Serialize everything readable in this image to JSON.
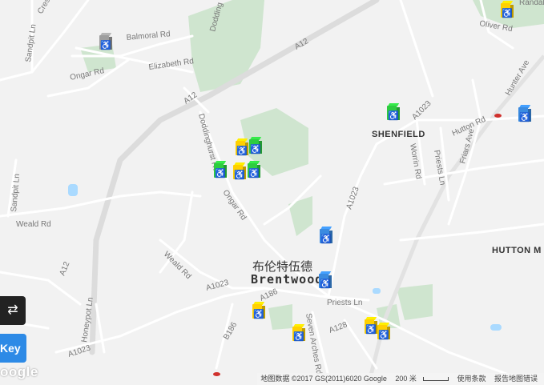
{
  "map": {
    "roads": {
      "crescent": "Crescent",
      "dodding_top": "Dodding",
      "sandpit_ln_top": "Sandpit Ln",
      "balmoral_rd": "Balmoral Rd",
      "elizabeth_rd": "Elizabeth Rd",
      "ongar_rd_top": "Ongar Rd",
      "a12_upper": "A12",
      "a12_mid": "A12",
      "a12_lower": "A12",
      "doddinghurst_rd": "Doddinghurst Rd",
      "ongar_rd_mid": "Ongar Rd",
      "sandpit_ln_left": "Sandpit Ln",
      "weald_rd_left": "Weald Rd",
      "weald_rd_mid": "Weald Rd",
      "a1023_mid": "A1023",
      "a1023_right": "A1023",
      "a1023_bottom": "A1023",
      "a1023_vertical": "A1023",
      "honeypot_ln": "Honeypot Ln",
      "b186": "B186",
      "a186": "A186",
      "a128": "A128",
      "priests_ln": "Priests Ln",
      "priests_ln_bottom": "Priests Ln",
      "seven_arches_rd": "Seven Arches Rd",
      "hutton_rd": "Hutton Rd",
      "hunter_ave": "Hunter Ave",
      "friars_ave": "Friars Ave",
      "worrin_rd": "Worrin Rd",
      "oliver_rd": "Oliver Rd",
      "randall": "Randall"
    },
    "places": {
      "shenfield": "SHENFIELD",
      "hutton": "HUTTON M",
      "brentwood_cn": "布伦特伍德",
      "brentwood": "Brentwood"
    },
    "markers": [
      {
        "id": "m1",
        "color": "#9e9e9e",
        "glyph": "♿"
      },
      {
        "id": "m2",
        "color": "#ffd000",
        "glyph": "♿"
      },
      {
        "id": "m3",
        "color": "#2ecc40",
        "glyph": "♿"
      },
      {
        "id": "m4",
        "color": "#3b8be0",
        "glyph": "♿"
      },
      {
        "id": "m5",
        "color": "#ffd000",
        "glyph": "♿"
      },
      {
        "id": "m6",
        "color": "#2ecc40",
        "glyph": "♿"
      },
      {
        "id": "m7",
        "color": "#2ecc40",
        "glyph": "♿"
      },
      {
        "id": "m8",
        "color": "#ffd000",
        "glyph": "♿"
      },
      {
        "id": "m9",
        "color": "#2ecc40",
        "glyph": "♿"
      },
      {
        "id": "m10",
        "color": "#3b8be0",
        "glyph": "♿"
      },
      {
        "id": "m11",
        "color": "#3b8be0",
        "glyph": "♿"
      },
      {
        "id": "m12",
        "color": "#ffd000",
        "glyph": "♿"
      },
      {
        "id": "m13",
        "color": "#ffd000",
        "glyph": "♿"
      },
      {
        "id": "m14",
        "color": "#ffd000",
        "glyph": "♿"
      },
      {
        "id": "m15",
        "color": "#ffd000",
        "glyph": "♿"
      }
    ]
  },
  "controls": {
    "swap_icon": "⇄",
    "key_label": "Key"
  },
  "google_logo": "oogle",
  "footer": {
    "map_data": "地图数据 ©2017 GS(2011)6020 Google",
    "scale": "200 米",
    "terms": "使用条款",
    "report": "报告地图错误"
  },
  "colors": {
    "background": "#f2f2f2",
    "park": "#cfe5cf",
    "water": "#aadaff",
    "road": "#ffffff",
    "highway": "#dcdcdc",
    "accent": "#2d8ae6"
  }
}
